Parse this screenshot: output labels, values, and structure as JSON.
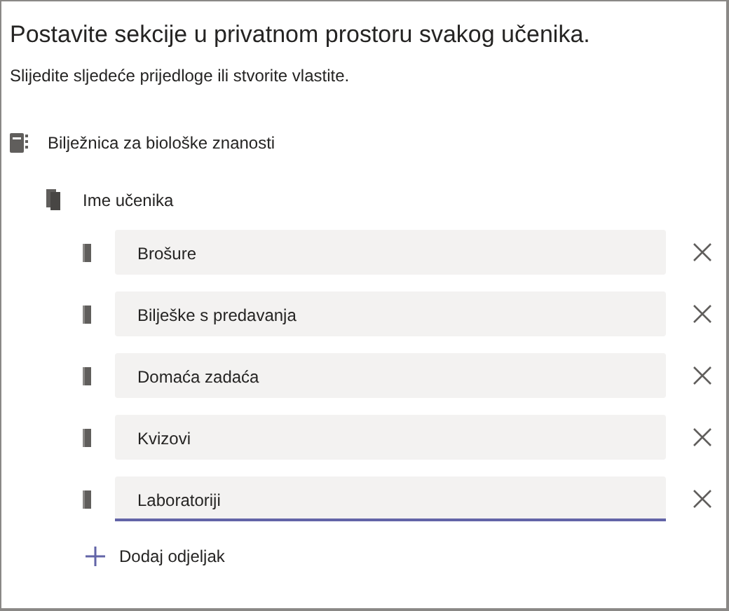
{
  "title": "Postavite sekcije u privatnom prostoru svakog učenika.",
  "subtitle": "Slijedite sljedeće prijedloge ili stvorite vlastite.",
  "notebook": "Bilježnica za biološke znanosti",
  "student": "Ime učenika",
  "sections": [
    {
      "value": "Brošure",
      "focused": false
    },
    {
      "value": "Bilješke s predavanja",
      "focused": false
    },
    {
      "value": "Domaća zadaća",
      "focused": false
    },
    {
      "value": "Kvizovi",
      "focused": false
    },
    {
      "value": "Laboratoriji",
      "focused": true
    }
  ],
  "add_label": "Dodaj odjeljak"
}
